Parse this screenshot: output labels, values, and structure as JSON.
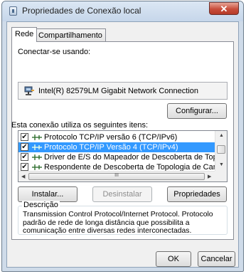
{
  "window": {
    "title": "Propriedades de Conexão local",
    "close_glyph": "✕"
  },
  "tabs": [
    {
      "label": "Rede"
    },
    {
      "label": "Compartilhamento"
    }
  ],
  "connect_using": {
    "label": "Conectar-se usando:",
    "adapter": "Intel(R) 82579LM Gigabit Network Connection",
    "configure_button": "Configurar..."
  },
  "items": {
    "label": "Esta conexão utiliza os seguintes itens:",
    "list": [
      {
        "checked": true,
        "text": "Protocolo TCP/IP versão 6 (TCP/IPv6)",
        "selected": false
      },
      {
        "checked": true,
        "text": "Protocolo TCP/IP Versão 4 (TCP/IPv4)",
        "selected": true
      },
      {
        "checked": true,
        "text": "Driver de E/S do Mapeador de Descoberta de Topologia",
        "selected": false
      },
      {
        "checked": true,
        "text": "Respondente de Descoberta de Topologia de Camada",
        "selected": false
      }
    ],
    "check_glyph": "✔",
    "scroll_grip": "III"
  },
  "actions": {
    "install": "Instalar...",
    "uninstall": "Desinstalar",
    "properties": "Propriedades"
  },
  "description": {
    "legend": "Descrição",
    "text": "Transmission Control Protocol/Internet Protocol. Protocolo padrão de rede de longa distância que possibilita a comunicação entre diversas redes interconectadas."
  },
  "footer": {
    "ok": "OK",
    "cancel": "Cancelar"
  },
  "icons": {
    "title": "network-properties-icon",
    "adapter": "network-adapter-icon",
    "protocol": "network-protocol-icon"
  }
}
